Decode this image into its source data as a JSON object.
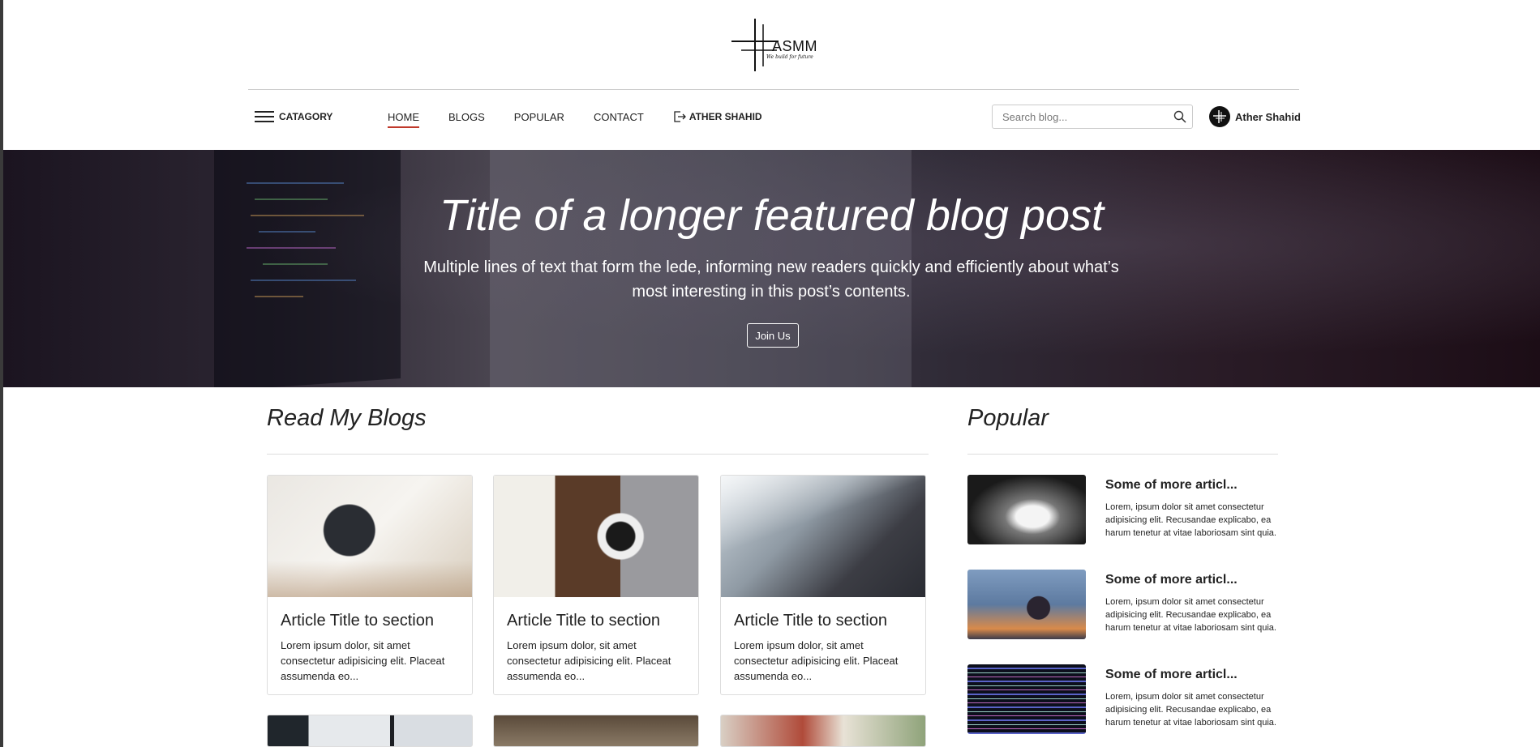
{
  "header": {
    "logo_text": "ASMM",
    "logo_tagline": "We build for future",
    "category_label": "CATAGORY",
    "nav": [
      {
        "label": "HOME",
        "active": true
      },
      {
        "label": "BLOGS",
        "active": false
      },
      {
        "label": "POPULAR",
        "active": false
      },
      {
        "label": "CONTACT",
        "active": false
      }
    ],
    "logout_label": "ATHER SHAHID",
    "search_placeholder": "Search blog...",
    "user_name": "Ather Shahid"
  },
  "hero": {
    "title": "Title of a longer featured blog post",
    "lede": "Multiple lines of text that form the lede, informing new readers quickly and efficiently about what’s most interesting in this post’s contents.",
    "button_label": "Join Us"
  },
  "blogs": {
    "heading": "Read My Blogs",
    "cards": [
      {
        "title": "Article Title to section",
        "text": "Lorem ipsum dolor, sit amet consectetur adipisicing elit. Placeat assumenda eo..."
      },
      {
        "title": "Article Title to section",
        "text": "Lorem ipsum dolor, sit amet consectetur adipisicing elit. Placeat assumenda eo..."
      },
      {
        "title": "Article Title to section",
        "text": "Lorem ipsum dolor, sit amet consectetur adipisicing elit. Placeat assumenda eo..."
      }
    ]
  },
  "popular": {
    "heading": "Popular",
    "items": [
      {
        "title": "Some of more articl...",
        "text": "Lorem, ipsum dolor sit amet consectetur adipisicing elit. Recusandae explicabo, ea harum tenetur at vitae laboriosam sint quia."
      },
      {
        "title": "Some of more articl...",
        "text": "Lorem, ipsum dolor sit amet consectetur adipisicing elit. Recusandae explicabo, ea harum tenetur at vitae laboriosam sint quia."
      },
      {
        "title": "Some of more articl...",
        "text": "Lorem, ipsum dolor sit amet consectetur adipisicing elit. Recusandae explicabo, ea harum tenetur at vitae laboriosam sint quia."
      }
    ]
  },
  "colors": {
    "accent_underline": "#c0392b",
    "text": "#222222"
  }
}
